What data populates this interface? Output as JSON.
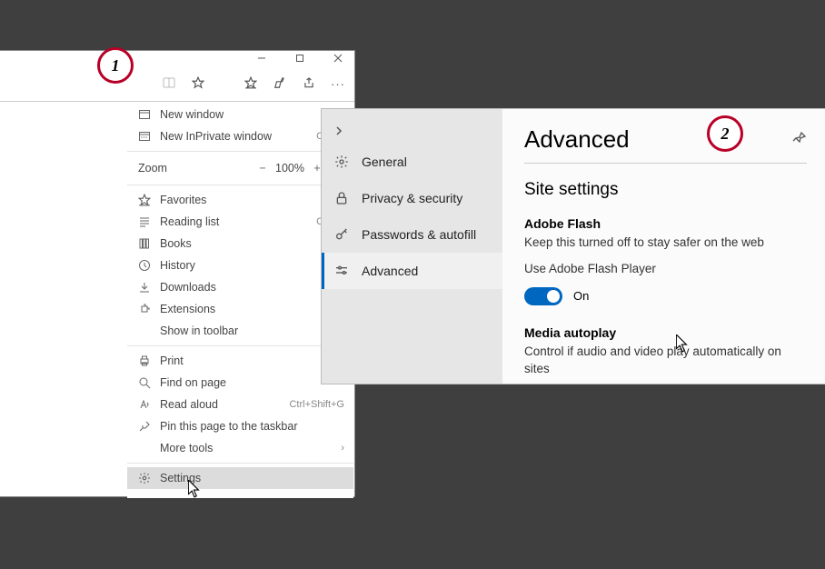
{
  "badges": {
    "one": "1",
    "two": "2"
  },
  "menu": {
    "new_window": "New window",
    "new_inprivate": "New InPrivate window",
    "new_inprivate_hint": "Ctrl+S",
    "zoom_label": "Zoom",
    "zoom_value": "100%",
    "favorites": "Favorites",
    "reading_list": "Reading list",
    "reading_list_hint": "Ctrl+S",
    "books": "Books",
    "history": "History",
    "downloads": "Downloads",
    "extensions": "Extensions",
    "show_in_toolbar": "Show in toolbar",
    "print": "Print",
    "find_on_page": "Find on page",
    "read_aloud": "Read aloud",
    "read_aloud_hint": "Ctrl+Shift+G",
    "pin_taskbar": "Pin this page to the taskbar",
    "more_tools": "More tools",
    "settings": "Settings"
  },
  "nav": {
    "general": "General",
    "privacy": "Privacy & security",
    "passwords": "Passwords & autofill",
    "advanced": "Advanced"
  },
  "advanced": {
    "title": "Advanced",
    "site_settings": "Site settings",
    "flash_heading": "Adobe Flash",
    "flash_desc": "Keep this turned off to stay safer on the web",
    "flash_toggle_label": "Use Adobe Flash Player",
    "flash_state": "On",
    "media_heading": "Media autoplay",
    "media_desc": "Control if audio and video play automatically on sites"
  }
}
